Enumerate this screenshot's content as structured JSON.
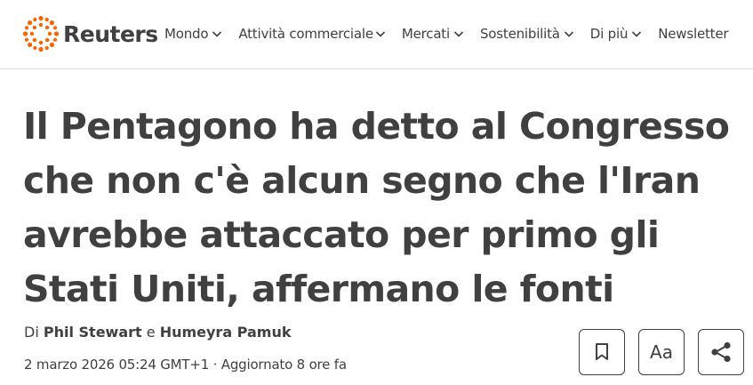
{
  "brand": {
    "name": "Reuters",
    "logo_icon": "reuters-dots-logo",
    "accent": "#fa6400"
  },
  "nav": {
    "items": [
      {
        "label": "Mondo",
        "has_dropdown": true
      },
      {
        "label": "Attività commerciale",
        "has_dropdown": true
      },
      {
        "label": "Mercati",
        "has_dropdown": true
      },
      {
        "label": "Sostenibilità",
        "has_dropdown": true
      },
      {
        "label": "Di più",
        "has_dropdown": true
      },
      {
        "label": "Newsletter",
        "has_dropdown": false
      }
    ]
  },
  "article": {
    "headline": "Il Pentagono ha detto al Congresso che non c'è alcun segno che l'Iran avrebbe attaccato per primo gli Stati Uniti, affermano le fonti",
    "byline": {
      "prefix": "Di",
      "author1": "Phil Stewart",
      "conjunction": "e",
      "author2": "Humeyra Pamuk"
    },
    "dateline": "2 marzo 2026 05:24 GMT+1 · Aggiornato 8 ore fa"
  },
  "actions": {
    "bookmark_icon": "bookmark-icon",
    "text_size_label": "Aa",
    "share_icon": "share-icon"
  }
}
